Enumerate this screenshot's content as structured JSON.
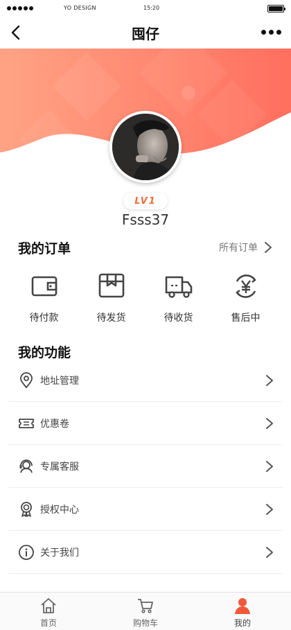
{
  "status_bar": {
    "carrier": "YO DESIGN",
    "time": "15:20"
  },
  "nav": {
    "title": "囤仔",
    "back_icon": "chevron-left-icon",
    "more_icon": "more-dots-icon"
  },
  "profile": {
    "level": "LV1",
    "username": "Fsss37"
  },
  "orders": {
    "title": "我的订单",
    "all_orders_label": "所有订单",
    "items": [
      {
        "label": "待付款",
        "icon": "wallet-icon"
      },
      {
        "label": "待发货",
        "icon": "package-icon"
      },
      {
        "label": "待收货",
        "icon": "truck-icon"
      },
      {
        "label": "售后中",
        "icon": "refund-yen-icon"
      }
    ]
  },
  "functions": {
    "title": "我的功能",
    "items": [
      {
        "label": "地址管理",
        "icon": "location-pin-icon"
      },
      {
        "label": "优惠卷",
        "icon": "coupon-icon"
      },
      {
        "label": "专属客服",
        "icon": "customer-service-icon"
      },
      {
        "label": "授权中心",
        "icon": "award-badge-icon"
      },
      {
        "label": "关于我们",
        "icon": "info-icon"
      }
    ]
  },
  "tab_bar": {
    "items": [
      {
        "label": "首页",
        "icon": "home-icon",
        "active": false
      },
      {
        "label": "购物车",
        "icon": "cart-icon",
        "active": false
      },
      {
        "label": "我的",
        "icon": "user-icon",
        "active": true
      }
    ]
  },
  "colors": {
    "accent": "#f26a3a",
    "banner_start": "#ff9e80",
    "banner_end": "#ff6a5a",
    "active_tab": "#f0583c"
  }
}
